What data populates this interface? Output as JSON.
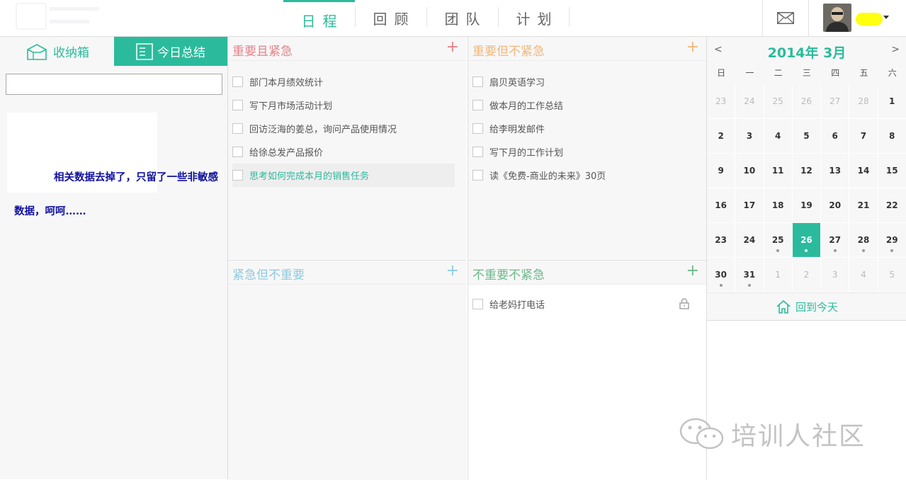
{
  "nav": {
    "tabs": [
      {
        "label": "日程",
        "active": true
      },
      {
        "label": "回顾",
        "active": false
      },
      {
        "label": "团队",
        "active": false
      },
      {
        "label": "计划",
        "active": false
      }
    ]
  },
  "header": {
    "mail_icon": "envelope-icon",
    "username_redacted": true
  },
  "left": {
    "inbox_label": "收纳箱",
    "summary_label": "今日总结",
    "search_value": "",
    "note_text": "相关数据去掉了，只留了一些非敏感数据，呵呵……"
  },
  "quadrants": {
    "q1": {
      "title": "重要且紧急",
      "color": "#e8828a",
      "tasks": [
        "部门本月绩效统计",
        "写下月市场活动计划",
        "回访泛海的姜总，询问产品使用情况",
        "给徐总发产品报价",
        "思考如何完成本月的销售任务"
      ]
    },
    "q2": {
      "title": "重要但不紧急",
      "color": "#f0b77c",
      "tasks": [
        "扇贝英语学习",
        "做本月的工作总结",
        "给李明发邮件",
        "写下月的工作计划",
        "读《免费-商业的未来》30页"
      ]
    },
    "q3": {
      "title": "紧急但不重要",
      "color": "#8ccbe0",
      "tasks": []
    },
    "q4": {
      "title": "不重要不紧急",
      "color": "#6cb98a",
      "tasks": [
        "给老妈打电话"
      ]
    }
  },
  "calendar": {
    "title": "2014年 3月",
    "prev": "<",
    "next": ">",
    "weekdays": [
      "日",
      "一",
      "二",
      "三",
      "四",
      "五",
      "六"
    ],
    "back_today": "回到今天",
    "days": [
      {
        "n": "23",
        "other": true
      },
      {
        "n": "24",
        "other": true
      },
      {
        "n": "25",
        "other": true
      },
      {
        "n": "26",
        "other": true
      },
      {
        "n": "27",
        "other": true
      },
      {
        "n": "28",
        "other": true
      },
      {
        "n": "1"
      },
      {
        "n": "2"
      },
      {
        "n": "3"
      },
      {
        "n": "4"
      },
      {
        "n": "5"
      },
      {
        "n": "6"
      },
      {
        "n": "7"
      },
      {
        "n": "8"
      },
      {
        "n": "9"
      },
      {
        "n": "10"
      },
      {
        "n": "11"
      },
      {
        "n": "12"
      },
      {
        "n": "13"
      },
      {
        "n": "14"
      },
      {
        "n": "15"
      },
      {
        "n": "16"
      },
      {
        "n": "17"
      },
      {
        "n": "18"
      },
      {
        "n": "19"
      },
      {
        "n": "20"
      },
      {
        "n": "21"
      },
      {
        "n": "22"
      },
      {
        "n": "23"
      },
      {
        "n": "24"
      },
      {
        "n": "25",
        "dot": true
      },
      {
        "n": "26",
        "today": true,
        "dot": true
      },
      {
        "n": "27",
        "dot": true
      },
      {
        "n": "28",
        "dot": true
      },
      {
        "n": "29",
        "dot": true
      },
      {
        "n": "30",
        "dot": true
      },
      {
        "n": "31",
        "dot": true
      },
      {
        "n": "1",
        "other": true
      },
      {
        "n": "2",
        "other": true
      },
      {
        "n": "3",
        "other": true
      },
      {
        "n": "4",
        "other": true
      },
      {
        "n": "5",
        "other": true
      }
    ]
  },
  "watermark": "培训人社区",
  "accent": "#2bbb9c"
}
